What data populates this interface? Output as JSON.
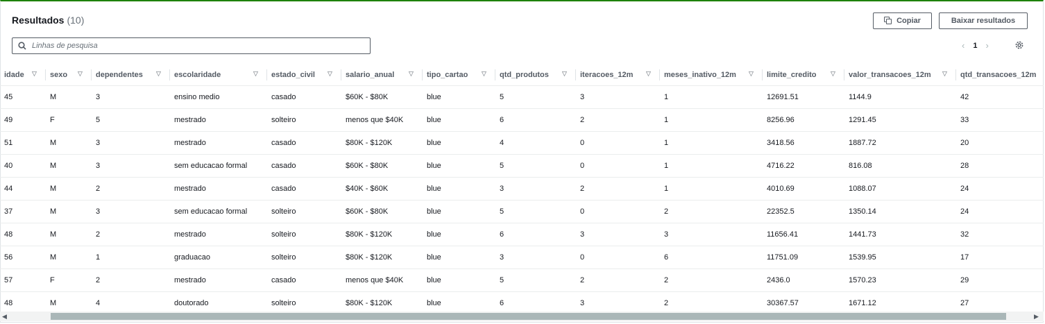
{
  "header": {
    "title": "Resultados",
    "count": "(10)",
    "copy_label": "Copiar",
    "download_label": "Baixar resultados"
  },
  "search": {
    "placeholder": "Linhas de pesquisa",
    "value": ""
  },
  "pagination": {
    "prev": "‹",
    "page": "1",
    "next": "›"
  },
  "columns": [
    {
      "key": "idade",
      "label": "idade"
    },
    {
      "key": "sexo",
      "label": "sexo"
    },
    {
      "key": "dependentes",
      "label": "dependentes"
    },
    {
      "key": "escolaridade",
      "label": "escolaridade"
    },
    {
      "key": "estado_civil",
      "label": "estado_civil"
    },
    {
      "key": "salario_anual",
      "label": "salario_anual"
    },
    {
      "key": "tipo_cartao",
      "label": "tipo_cartao"
    },
    {
      "key": "qtd_produtos",
      "label": "qtd_produtos"
    },
    {
      "key": "iteracoes_12m",
      "label": "iteracoes_12m"
    },
    {
      "key": "meses_inativo_12m",
      "label": "meses_inativo_12m"
    },
    {
      "key": "limite_credito",
      "label": "limite_credito"
    },
    {
      "key": "valor_transacoes_12m",
      "label": "valor_transacoes_12m"
    },
    {
      "key": "qtd_transacoes_12m",
      "label": "qtd_transacoes_12m"
    }
  ],
  "rows": [
    [
      "45",
      "M",
      "3",
      "ensino medio",
      "casado",
      "$60K - $80K",
      "blue",
      "5",
      "3",
      "1",
      "12691.51",
      "1144.9",
      "42"
    ],
    [
      "49",
      "F",
      "5",
      "mestrado",
      "solteiro",
      "menos que $40K",
      "blue",
      "6",
      "2",
      "1",
      "8256.96",
      "1291.45",
      "33"
    ],
    [
      "51",
      "M",
      "3",
      "mestrado",
      "casado",
      "$80K - $120K",
      "blue",
      "4",
      "0",
      "1",
      "3418.56",
      "1887.72",
      "20"
    ],
    [
      "40",
      "M",
      "3",
      "sem educacao formal",
      "casado",
      "$60K - $80K",
      "blue",
      "5",
      "0",
      "1",
      "4716.22",
      "816.08",
      "28"
    ],
    [
      "44",
      "M",
      "2",
      "mestrado",
      "casado",
      "$40K - $60K",
      "blue",
      "3",
      "2",
      "1",
      "4010.69",
      "1088.07",
      "24"
    ],
    [
      "37",
      "M",
      "3",
      "sem educacao formal",
      "solteiro",
      "$60K - $80K",
      "blue",
      "5",
      "0",
      "2",
      "22352.5",
      "1350.14",
      "24"
    ],
    [
      "48",
      "M",
      "2",
      "mestrado",
      "solteiro",
      "$80K - $120K",
      "blue",
      "6",
      "3",
      "3",
      "11656.41",
      "1441.73",
      "32"
    ],
    [
      "56",
      "M",
      "1",
      "graduacao",
      "solteiro",
      "$80K - $120K",
      "blue",
      "3",
      "0",
      "6",
      "11751.09",
      "1539.95",
      "17"
    ],
    [
      "57",
      "F",
      "2",
      "mestrado",
      "casado",
      "menos que $40K",
      "blue",
      "5",
      "2",
      "2",
      "2436.0",
      "1570.23",
      "29"
    ],
    [
      "48",
      "M",
      "4",
      "doutorado",
      "solteiro",
      "$80K - $120K",
      "blue",
      "6",
      "3",
      "2",
      "30367.57",
      "1671.12",
      "27"
    ]
  ],
  "icons": {
    "copy": "copy-icon",
    "search": "search-icon",
    "settings": "gear-icon",
    "filter": "filter-triangle-icon"
  },
  "colors": {
    "accent_border": "#1d8102",
    "text": "#16191f",
    "muted": "#545b64"
  }
}
